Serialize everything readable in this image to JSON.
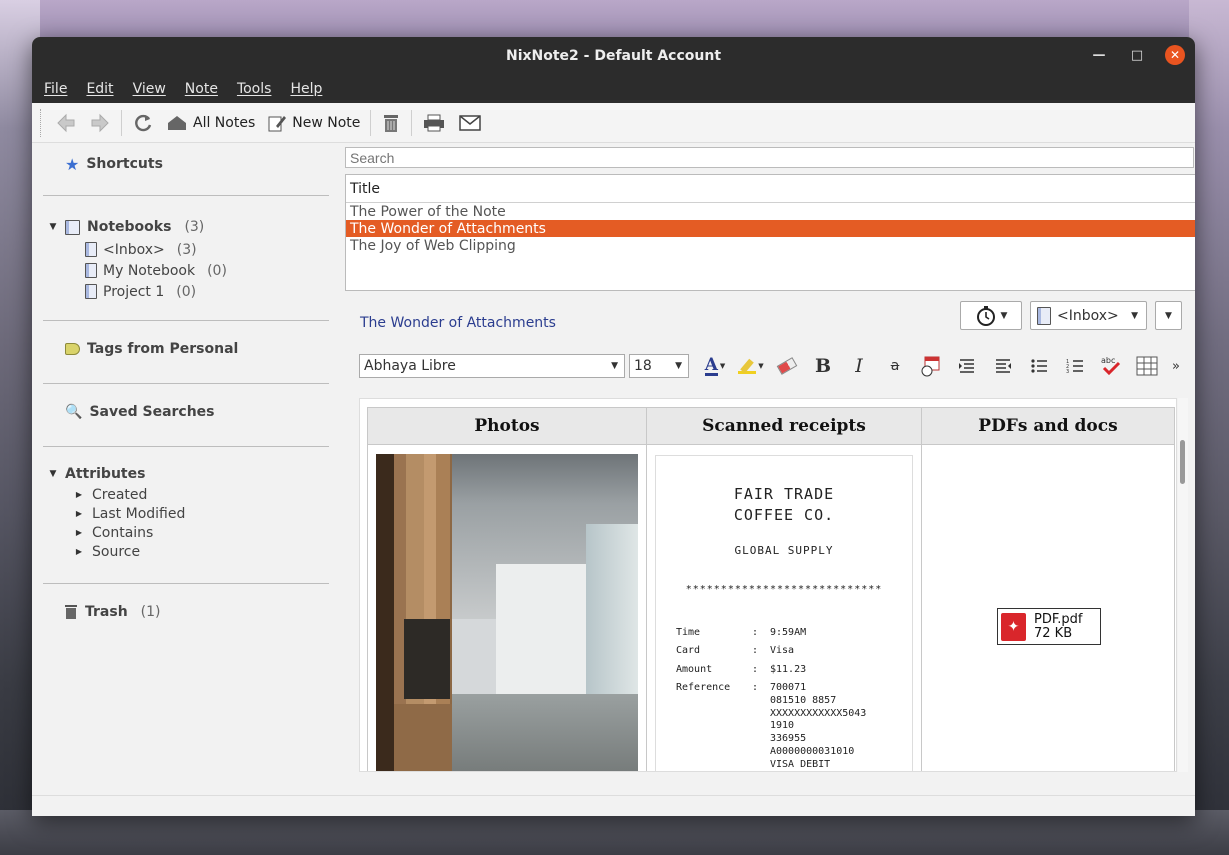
{
  "window": {
    "title": "NixNote2 - Default Account"
  },
  "menu": [
    "File",
    "Edit",
    "View",
    "Note",
    "Tools",
    "Help"
  ],
  "toolbar": {
    "all_notes": "All Notes",
    "new_note": "New Note"
  },
  "sidebar": {
    "shortcuts": "Shortcuts",
    "notebooks": {
      "label": "Notebooks",
      "count": "(3)",
      "items": [
        {
          "label": "<Inbox>",
          "count": "(3)"
        },
        {
          "label": "My Notebook",
          "count": "(0)"
        },
        {
          "label": "Project 1",
          "count": "(0)"
        }
      ]
    },
    "tags": "Tags from Personal",
    "saved_searches": "Saved Searches",
    "attributes": {
      "label": "Attributes",
      "items": [
        "Created",
        "Last Modified",
        "Contains",
        "Source"
      ]
    },
    "trash": {
      "label": "Trash",
      "count": "(1)"
    }
  },
  "search": {
    "placeholder": "Search"
  },
  "note_list": {
    "header": "Title",
    "rows": [
      "The Power of the Note",
      "The Wonder of Attachments",
      "The Joy of Web Clipping"
    ],
    "selected_index": 1
  },
  "editor": {
    "note_title": "The Wonder of Attachments",
    "notebook_combo": "<Inbox>",
    "font": "Abhaya Libre",
    "font_size": "18",
    "table_headers": [
      "Photos",
      "Scanned receipts",
      "PDFs and docs"
    ],
    "receipt": {
      "title_line1": "FAIR TRADE",
      "title_line2": "COFFEE CO.",
      "subtitle": "GLOBAL SUPPLY",
      "stars": "****************************",
      "rows": [
        {
          "k": "Time",
          "v": "9:59AM"
        },
        {
          "k": "Card",
          "v": "Visa"
        },
        {
          "k": "Amount",
          "v": "$11.23"
        },
        {
          "k": "Reference",
          "v": "700071\n081510 8857\nXXXXXXXXXXXX5043\n1910\n336955\nA0000000031010\nVISA DEBIT"
        }
      ]
    },
    "pdf": {
      "name": "PDF.pdf",
      "size": "72 KB"
    }
  },
  "colors": {
    "accent": "#e45c24",
    "title_link": "#2b3d8f",
    "titlebar": "#2c2c2c",
    "close": "#e95420"
  }
}
